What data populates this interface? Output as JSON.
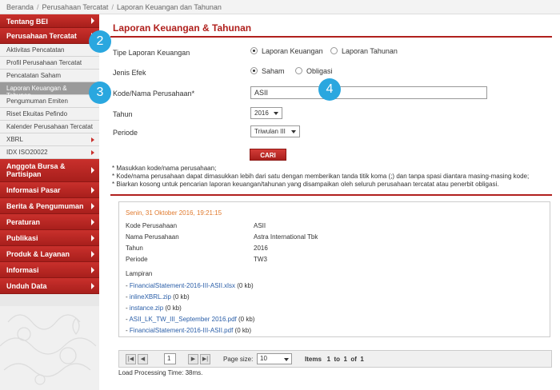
{
  "breadcrumb": [
    "Beranda",
    "Perusahaan Tercatat",
    "Laporan Keuangan dan Tahunan"
  ],
  "sidebar": {
    "top": [
      {
        "label": "Tentang BEI"
      },
      {
        "label": "Perusahaan Tercatat"
      }
    ],
    "sub": [
      {
        "label": "Aktivitas Pencatatan"
      },
      {
        "label": "Profil Perusahaan Tercatat"
      },
      {
        "label": "Pencatatan Saham"
      },
      {
        "label": "Laporan Keuangan & Tahunan"
      },
      {
        "label": "Pengumuman Emiten"
      },
      {
        "label": "Riset Ekuitas Pefindo"
      },
      {
        "label": "Kalender Perusahaan Tercatat"
      },
      {
        "label": "XBRL"
      },
      {
        "label": "IDX ISO20022"
      }
    ],
    "bottom": [
      {
        "label": "Anggota Bursa & Partisipan"
      },
      {
        "label": "Informasi Pasar"
      },
      {
        "label": "Berita & Pengumuman"
      },
      {
        "label": "Peraturan"
      },
      {
        "label": "Publikasi"
      },
      {
        "label": "Produk & Layanan"
      },
      {
        "label": "Informasi"
      },
      {
        "label": "Unduh Data"
      }
    ]
  },
  "main": {
    "title": "Laporan Keuangan & Tahunan",
    "form": {
      "tipe_label": "Tipe Laporan Keuangan",
      "tipe_opt1": "Laporan Keuangan",
      "tipe_opt2": "Laporan Tahunan",
      "jenis_label": "Jenis Efek",
      "jenis_opt1": "Saham",
      "jenis_opt2": "Obligasi",
      "kode_label": "Kode/Nama Perusahaan*",
      "kode_value": "ASII",
      "tahun_label": "Tahun",
      "tahun_value": "2016",
      "periode_label": "Periode",
      "periode_value": "Triwulan III",
      "cari": "CARI"
    },
    "notes": [
      "* Masukkan kode/nama perusahaan;",
      "* Kode/nama perusahaan dapat dimasukkan lebih dari satu dengan memberikan tanda titik koma (;) dan tanpa spasi diantara masing-masing kode;",
      "* Biarkan kosong untuk pencarian laporan keuangan/tahunan yang disampaikan oleh seluruh perusahaan tercatat atau penerbit obligasi."
    ],
    "result": {
      "date": "Senin, 31 Oktober 2016, 19:21:15",
      "rows": [
        {
          "k": "Kode Perusahaan",
          "v": "ASII"
        },
        {
          "k": "Nama Perusahaan",
          "v": "Astra International Tbk"
        },
        {
          "k": "Tahun",
          "v": "2016"
        },
        {
          "k": "Periode",
          "v": "TW3"
        }
      ],
      "lampiran_label": "Lampiran",
      "files": [
        {
          "name": "FinancialStatement-2016-III-ASII.xlsx",
          "size": "(0 kb)"
        },
        {
          "name": "inlineXBRL.zip",
          "size": "(0 kb)"
        },
        {
          "name": "instance.zip",
          "size": "(0 kb)"
        },
        {
          "name": "ASII_LK_TW_III_September 2016.pdf",
          "size": "(0 kb)"
        },
        {
          "name": "FinancialStatement-2016-III-ASII.pdf",
          "size": "(0 kb)"
        }
      ]
    },
    "pager": {
      "page": "1",
      "page_size_label": "Page size:",
      "page_size": "10",
      "items_label": "Items",
      "from": "1",
      "to_label": "to",
      "to": "1",
      "of_label": "of",
      "total": "1"
    },
    "load": "Load Processing Time: 38ms."
  },
  "steps": [
    "2",
    "3",
    "4"
  ],
  "colors": {
    "accent": "#b0201d",
    "step": "#2aa7df",
    "date": "#e07a2e",
    "link": "#2a5ea8"
  },
  "icons": {
    "first": "first-page-icon",
    "prev": "prev-page-icon",
    "next": "next-page-icon",
    "last": "last-page-icon"
  }
}
